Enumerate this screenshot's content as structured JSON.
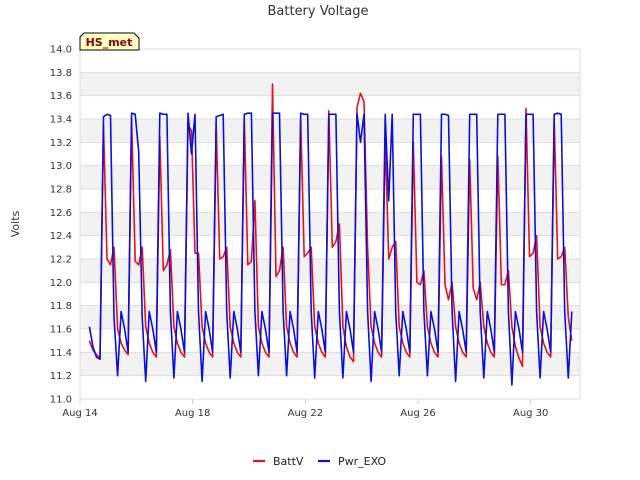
{
  "chart_data": {
    "type": "line",
    "title": "Battery Voltage",
    "ylabel": "Volts",
    "xlabel": "",
    "badge": "HS_met",
    "xlim": [
      "2021-08-14",
      "2021-08-31T18:00"
    ],
    "ylim": [
      11.0,
      14.0
    ],
    "y_ticks": [
      "11.0",
      "11.2",
      "11.4",
      "11.6",
      "11.8",
      "12.0",
      "12.2",
      "12.4",
      "12.6",
      "12.8",
      "13.0",
      "13.2",
      "13.4",
      "13.6",
      "13.8",
      "14.0"
    ],
    "x_ticks": [
      {
        "label": "Aug 14",
        "date": "2021-08-14"
      },
      {
        "label": "Aug 18",
        "date": "2021-08-18"
      },
      {
        "label": "Aug 22",
        "date": "2021-08-22"
      },
      {
        "label": "Aug 26",
        "date": "2021-08-26"
      },
      {
        "label": "Aug 30",
        "date": "2021-08-30"
      }
    ],
    "series": [
      {
        "name": "BattV",
        "color": "#e8101a",
        "start": "2021-08-14T08:00",
        "step_hours": 3,
        "values": [
          11.5,
          11.42,
          11.38,
          11.35,
          13.35,
          12.2,
          12.15,
          12.3,
          11.6,
          11.48,
          11.42,
          11.38,
          13.4,
          12.18,
          12.15,
          12.3,
          11.62,
          11.48,
          11.4,
          11.36,
          13.25,
          12.1,
          12.15,
          12.28,
          11.62,
          11.48,
          11.4,
          11.36,
          13.35,
          13.3,
          12.25,
          12.25,
          11.62,
          11.48,
          11.4,
          11.36,
          13.35,
          12.2,
          12.22,
          12.3,
          11.62,
          11.48,
          11.4,
          11.36,
          13.4,
          12.15,
          12.18,
          12.7,
          11.62,
          11.48,
          11.4,
          11.36,
          13.7,
          12.05,
          12.1,
          12.3,
          11.62,
          11.48,
          11.4,
          11.36,
          13.4,
          12.22,
          12.25,
          12.3,
          11.62,
          11.48,
          11.4,
          11.36,
          13.47,
          12.3,
          12.35,
          12.5,
          11.62,
          11.45,
          11.36,
          11.32,
          13.5,
          13.62,
          13.55,
          12.3,
          11.62,
          11.48,
          11.4,
          11.36,
          13.25,
          12.2,
          12.3,
          12.35,
          11.62,
          11.48,
          11.4,
          11.36,
          13.2,
          12.0,
          11.98,
          12.1,
          11.62,
          11.48,
          11.4,
          11.36,
          13.08,
          11.98,
          11.85,
          12.0,
          11.62,
          11.48,
          11.4,
          11.36,
          13.05,
          11.95,
          11.85,
          12.0,
          11.62,
          11.48,
          11.4,
          11.36,
          13.08,
          11.98,
          11.98,
          12.1,
          11.62,
          11.45,
          11.35,
          11.28,
          13.49,
          12.22,
          12.25,
          12.4,
          11.62,
          11.48,
          11.4,
          11.36,
          13.4,
          12.2,
          12.22,
          12.3,
          11.7,
          11.5
        ]
      },
      {
        "name": "Pwr_EXO",
        "color": "#0a10d8",
        "start": "2021-08-14T08:00",
        "step_hours": 3,
        "values": [
          11.62,
          11.45,
          11.36,
          11.34,
          13.42,
          13.44,
          13.43,
          11.7,
          11.2,
          11.75,
          11.6,
          11.4,
          13.45,
          13.44,
          13.12,
          11.7,
          11.15,
          11.75,
          11.6,
          11.4,
          13.45,
          13.44,
          13.44,
          11.75,
          11.18,
          11.75,
          11.6,
          11.4,
          13.45,
          13.1,
          13.44,
          11.75,
          11.15,
          11.75,
          11.6,
          11.4,
          13.42,
          13.43,
          13.44,
          11.75,
          11.18,
          11.75,
          11.6,
          11.4,
          13.44,
          13.45,
          13.45,
          11.75,
          11.2,
          11.75,
          11.6,
          11.4,
          13.45,
          13.45,
          13.45,
          11.75,
          11.2,
          11.75,
          11.6,
          11.4,
          13.45,
          13.44,
          13.44,
          11.75,
          11.18,
          11.75,
          11.6,
          11.4,
          13.44,
          13.44,
          13.44,
          11.75,
          11.18,
          11.75,
          11.6,
          11.4,
          13.45,
          13.2,
          13.44,
          11.75,
          11.15,
          11.75,
          11.6,
          11.4,
          13.44,
          12.7,
          13.44,
          11.75,
          11.2,
          11.75,
          11.6,
          11.4,
          13.44,
          13.44,
          13.44,
          11.75,
          11.2,
          11.75,
          11.6,
          11.4,
          13.44,
          13.44,
          13.43,
          11.75,
          11.15,
          11.75,
          11.6,
          11.4,
          13.44,
          13.44,
          13.44,
          11.75,
          11.18,
          11.75,
          11.6,
          11.4,
          13.44,
          13.44,
          13.44,
          11.75,
          11.12,
          11.75,
          11.6,
          11.4,
          13.44,
          13.44,
          13.44,
          11.75,
          11.18,
          11.75,
          11.6,
          11.4,
          13.44,
          13.45,
          13.44,
          11.75,
          11.18,
          11.75
        ]
      }
    ],
    "legend_position": "bottom-center",
    "grid": true
  }
}
